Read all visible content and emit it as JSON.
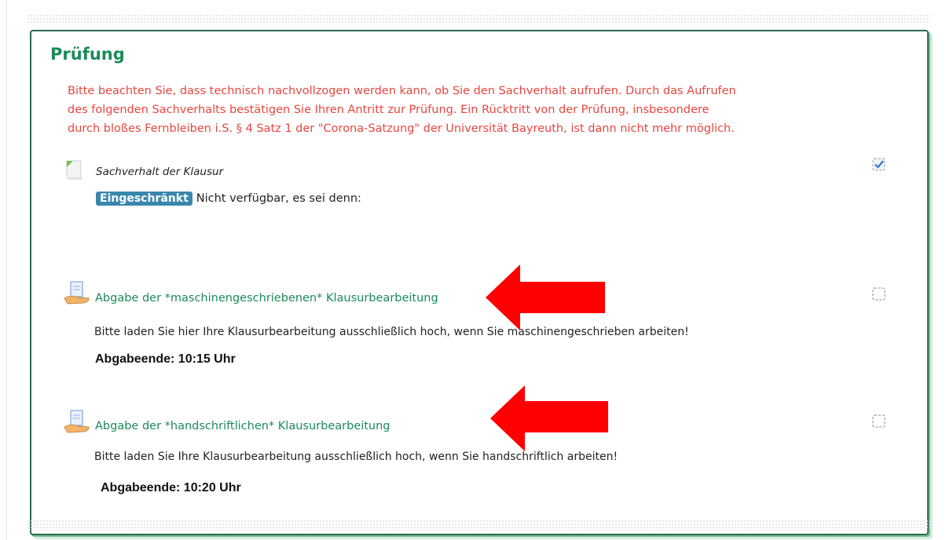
{
  "section": {
    "title": "Prüfung",
    "notice_lines": [
      "Bitte beachten Sie, dass technisch nachvollzogen werden kann, ob Sie den Sachverhalt aufrufen. Durch das Aufrufen",
      "des folgenden Sachverhalts bestätigen Sie Ihren Antritt zur Prüfung. Ein Rücktritt von der Prüfung, insbesondere",
      "durch bloßes Fernbleiben i.S. § 4 Satz 1 der \"Corona-Satzung\" der Universität Bayreuth, ist dann nicht mehr möglich."
    ]
  },
  "activities": [
    {
      "title": "Sachverhalt der Klausur",
      "icon": "page-icon",
      "restriction_badge": "Eingeschränkt",
      "restriction_text": "Nicht verfügbar, es sei denn:",
      "completion": "checked"
    },
    {
      "title": "Abgabe der *maschinengeschriebenen* Klausurbearbeitung",
      "icon": "assignment-icon",
      "description": "Bitte laden Sie hier Ihre Klausurbearbeitung ausschließlich hoch, wenn Sie maschinengeschrieben arbeiten!",
      "deadline": "Abgabeende: 10:15 Uhr",
      "completion": "unchecked"
    },
    {
      "title": "Abgabe der *handschriftlichen* Klausurbearbeitung",
      "icon": "assignment-icon",
      "description": "Bitte laden Sie Ihre Klausurbearbeitung ausschließlich hoch, wenn Sie handschriftlich arbeiten!",
      "deadline": "Abgabeende: 10:20 Uhr",
      "completion": "unchecked"
    }
  ],
  "colors": {
    "title_green": "#1b8a5a",
    "notice_red": "#e8463e",
    "badge_blue": "#3a87ad",
    "arrow_red": "#ff0000",
    "border_green": "#2a6b4c"
  }
}
